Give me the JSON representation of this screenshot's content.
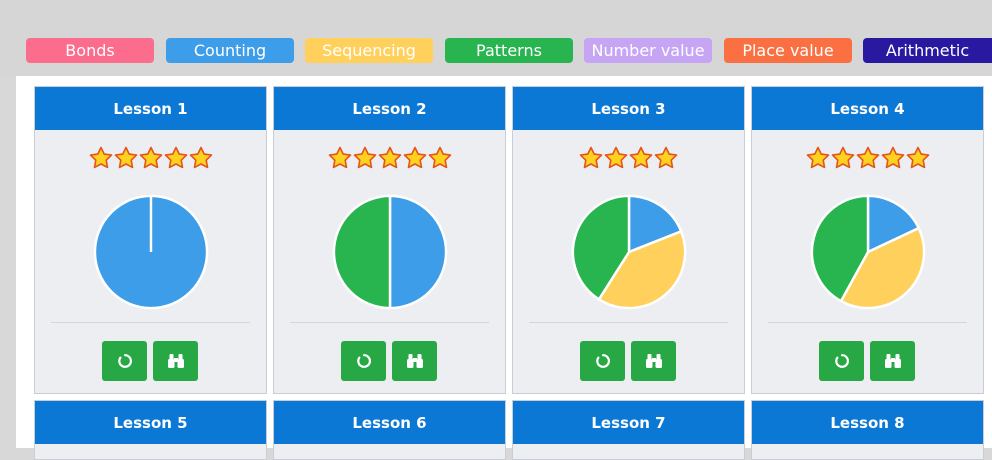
{
  "categories": [
    {
      "label": "Bonds",
      "color": "#fc6c8d"
    },
    {
      "label": "Counting",
      "color": "#3d9de8"
    },
    {
      "label": "Sequencing",
      "color": "#ffd15c"
    },
    {
      "label": "Patterns",
      "color": "#28b44f"
    },
    {
      "label": "Number value",
      "color": "#c6a5f5"
    },
    {
      "label": "Place value",
      "color": "#fa7043"
    },
    {
      "label": "Arithmetic",
      "color": "#2819a0"
    }
  ],
  "lessons": [
    {
      "title": "Lesson 1",
      "stars": 5,
      "breakdown": [
        {
          "category": "Counting",
          "value": 100
        }
      ]
    },
    {
      "title": "Lesson 2",
      "stars": 5,
      "breakdown": [
        {
          "category": "Counting",
          "value": 50
        },
        {
          "category": "Patterns",
          "value": 50
        }
      ]
    },
    {
      "title": "Lesson 3",
      "stars": 4,
      "breakdown": [
        {
          "category": "Counting",
          "value": 19
        },
        {
          "category": "Sequencing",
          "value": 40
        },
        {
          "category": "Patterns",
          "value": 41
        }
      ]
    },
    {
      "title": "Lesson 4",
      "stars": 5,
      "breakdown": [
        {
          "category": "Counting",
          "value": 18
        },
        {
          "category": "Sequencing",
          "value": 40
        },
        {
          "category": "Patterns",
          "value": 42
        }
      ]
    },
    {
      "title": "Lesson 5"
    },
    {
      "title": "Lesson 6"
    },
    {
      "title": "Lesson 7"
    },
    {
      "title": "Lesson 8"
    }
  ],
  "icons": {
    "retry": "circle-arrow-icon",
    "review": "binoculars-icon"
  }
}
